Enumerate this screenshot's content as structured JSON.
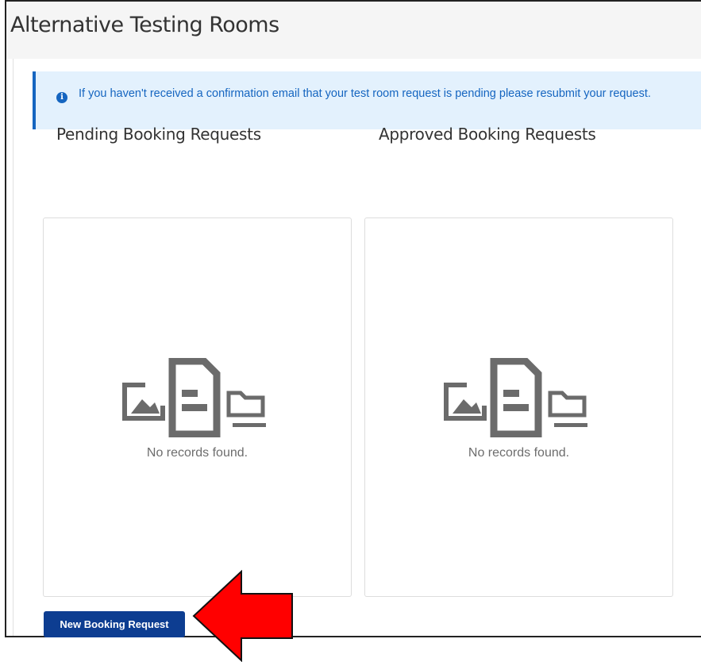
{
  "page": {
    "title": "Alternative Testing Rooms"
  },
  "alert": {
    "icon": "info-circle-icon",
    "message": "If you haven't received a confirmation email that your test room request is pending please resubmit your request.",
    "color": "#1565c0",
    "background": "#e3f1fd"
  },
  "panels": [
    {
      "title": "Pending Booking Requests",
      "empty_icon": "no-records-icon",
      "empty_text": "No records found."
    },
    {
      "title": "Approved Booking Requests",
      "empty_icon": "no-records-icon",
      "empty_text": "No records found."
    }
  ],
  "actions": {
    "new_booking_label": "New Booking Request",
    "button_color": "#0d3d91"
  },
  "annotation": {
    "icon": "red-arrow-icon",
    "color": "#ff0000"
  }
}
